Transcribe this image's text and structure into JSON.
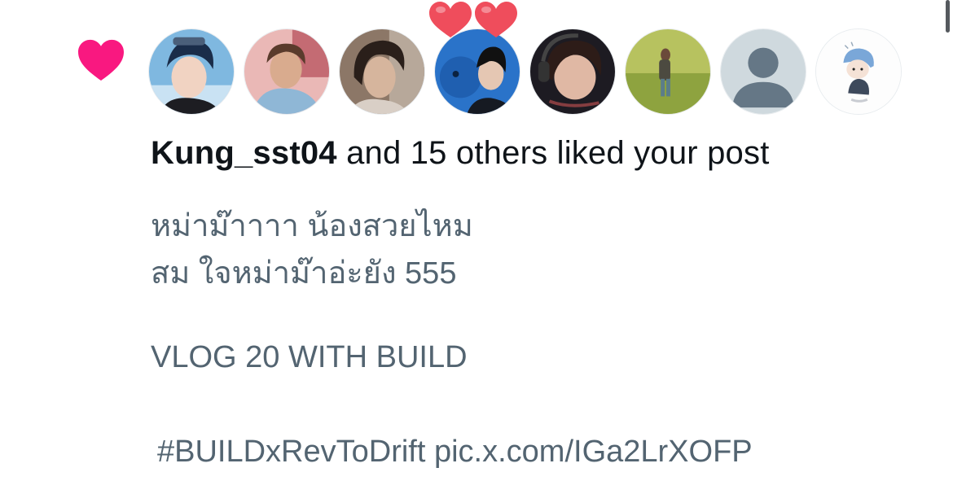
{
  "notification": {
    "type_icon": "heart-icon",
    "liker_username": "Kung_sst04",
    "summary_rest": " and 15 others liked your post",
    "avatars": [
      {
        "icon": "avatar-photo"
      },
      {
        "icon": "avatar-photo"
      },
      {
        "icon": "avatar-photo"
      },
      {
        "icon": "avatar-photo"
      },
      {
        "icon": "avatar-photo"
      },
      {
        "icon": "avatar-photo"
      },
      {
        "icon": "default-avatar-icon"
      },
      {
        "icon": "avatar-illustration"
      }
    ],
    "post": {
      "line1": "หม่าม๊าาาา น้องสวยไหม",
      "line2": "สม ใจหม่าม๊าอ่ะยัง 555",
      "line3": "VLOG 20 WITH BUILD",
      "line4": "#BUILDxRevToDrift pic.x.com/IGa2LrXOFP"
    }
  },
  "colors": {
    "like_pink": "#f91880",
    "primary_text": "#0f1419",
    "secondary_text": "#536471",
    "heart_sticker": "#ef4d5c"
  }
}
